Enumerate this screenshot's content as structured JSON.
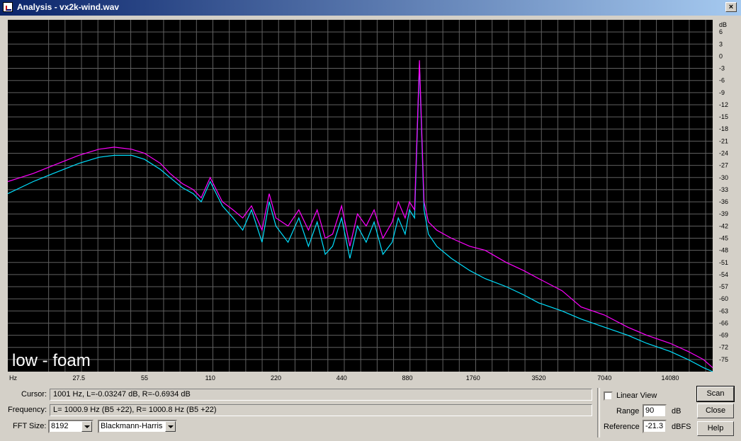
{
  "window": {
    "title": "Analysis - vx2k-wind.wav"
  },
  "plot": {
    "overlay_label": "low - foam",
    "y_unit": "dB",
    "x_unit": "Hz",
    "y_ticks": [
      "6",
      "3",
      "0",
      "-3",
      "-6",
      "-9",
      "-12",
      "-15",
      "-18",
      "-21",
      "-24",
      "-27",
      "-30",
      "-33",
      "-36",
      "-39",
      "-42",
      "-45",
      "-48",
      "-51",
      "-54",
      "-57",
      "-60",
      "-63",
      "-66",
      "-69",
      "-72",
      "-75"
    ],
    "x_ticks": [
      "27.5",
      "55",
      "110",
      "220",
      "440",
      "880",
      "1760",
      "3520",
      "7040",
      "14080"
    ],
    "colors": {
      "background": "#000000",
      "grid": "#606060",
      "left": "#ff00ff",
      "right": "#00e0ff",
      "axis_text": "#000000"
    }
  },
  "chart_data": {
    "type": "line",
    "x_scale": "log",
    "xlim": [
      13,
      22050
    ],
    "ylim": [
      -78,
      9
    ],
    "ylabel": "dB",
    "xlabel": "Hz",
    "series": [
      {
        "color": "#ff00ff",
        "x": [
          13,
          17,
          21,
          27.5,
          34,
          40,
          48,
          55,
          65,
          72,
          82,
          92,
          100,
          110,
          125,
          140,
          155,
          170,
          190,
          205,
          220,
          250,
          280,
          310,
          340,
          370,
          400,
          440,
          480,
          520,
          570,
          620,
          680,
          750,
          800,
          860,
          900,
          950,
          1000,
          1050,
          1100,
          1200,
          1400,
          1700,
          2000,
          2500,
          3000,
          3520,
          4500,
          5500,
          7040,
          9000,
          11000,
          14080,
          17000,
          20000,
          22050
        ],
        "y": [
          -31,
          -29,
          -27,
          -24.5,
          -23,
          -22.5,
          -23,
          -24,
          -26.5,
          -29,
          -31.5,
          -33,
          -35,
          -30,
          -36,
          -38,
          -40,
          -37,
          -43,
          -34,
          -40,
          -42,
          -38,
          -43,
          -38,
          -45,
          -44,
          -37,
          -47,
          -39,
          -42,
          -38,
          -45,
          -41,
          -36,
          -40,
          -36,
          -38,
          -1,
          -36,
          -41,
          -43,
          -45,
          -47,
          -48,
          -51,
          -53,
          -55,
          -58,
          -62,
          -64,
          -67,
          -69,
          -71,
          -73,
          -75,
          -77
        ]
      },
      {
        "color": "#00e0ff",
        "x": [
          13,
          17,
          21,
          27.5,
          34,
          40,
          48,
          55,
          65,
          72,
          82,
          92,
          100,
          110,
          125,
          140,
          155,
          170,
          190,
          205,
          220,
          250,
          280,
          310,
          340,
          370,
          400,
          440,
          480,
          520,
          570,
          620,
          680,
          750,
          800,
          860,
          900,
          950,
          1000,
          1050,
          1100,
          1200,
          1400,
          1700,
          2000,
          2500,
          3000,
          3520,
          4500,
          5500,
          7040,
          9000,
          11000,
          14080,
          17000,
          20000,
          22050
        ],
        "y": [
          -34,
          -31,
          -29,
          -26.5,
          -25,
          -24.5,
          -24.5,
          -25.5,
          -28,
          -30,
          -32.5,
          -34,
          -36,
          -31,
          -37,
          -40,
          -43,
          -38,
          -46,
          -36,
          -42,
          -46,
          -40,
          -47,
          -41,
          -49,
          -47,
          -40,
          -50,
          -42,
          -46,
          -41,
          -49,
          -46,
          -40,
          -44,
          -38,
          -40,
          -2,
          -38,
          -44,
          -47,
          -50,
          -53,
          -55,
          -57,
          -59,
          -61,
          -63,
          -65,
          -67,
          -69,
          -71,
          -73,
          -75,
          -77,
          -78
        ]
      }
    ]
  },
  "controls": {
    "cursor_label": "Cursor:",
    "cursor_value": "1001 Hz, L=-0.03247 dB, R=-0.6934 dB",
    "frequency_label": "Frequency:",
    "frequency_value": "L= 1000.9 Hz (B5 +22), R= 1000.8 Hz (B5 +22)",
    "fft_label": "FFT Size:",
    "fft_value": "8192",
    "window_value": "Blackmann-Harris",
    "linear_view_label": "Linear View",
    "range_label": "Range",
    "range_value": "90",
    "range_unit": "dB",
    "reference_label": "Reference",
    "reference_value": "-21.3",
    "reference_unit": "dBFS",
    "scan_label": "Scan",
    "close_label": "Close",
    "help_label": "Help"
  }
}
